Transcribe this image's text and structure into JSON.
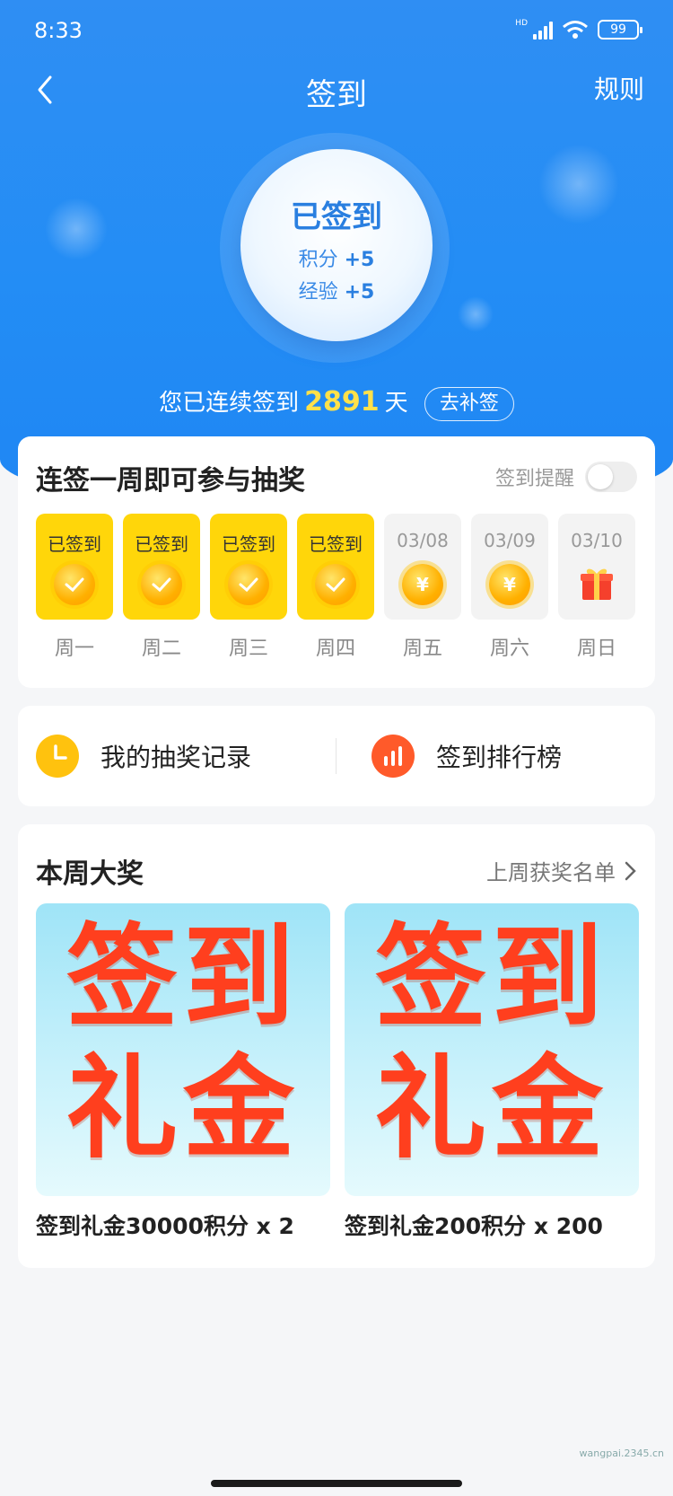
{
  "status_bar": {
    "time": "8:33",
    "network": "HD",
    "battery": "99"
  },
  "nav": {
    "title": "签到",
    "rules": "规则"
  },
  "sign_circle": {
    "status": "已签到",
    "points_label": "积分",
    "points_value": "+5",
    "exp_label": "经验",
    "exp_value": "+5"
  },
  "streak": {
    "prefix": "您已连续签到",
    "days": "2891",
    "suffix": "天",
    "makeup_button": "去补签"
  },
  "week_card": {
    "title": "连签一周即可参与抽奖",
    "reminder_label": "签到提醒",
    "reminder_on": false,
    "days": [
      {
        "label": "已签到",
        "name": "周一",
        "state": "done",
        "icon": "check-coin-icon"
      },
      {
        "label": "已签到",
        "name": "周二",
        "state": "done",
        "icon": "check-coin-icon"
      },
      {
        "label": "已签到",
        "name": "周三",
        "state": "done",
        "icon": "check-coin-icon"
      },
      {
        "label": "已签到",
        "name": "周四",
        "state": "done",
        "icon": "check-coin-icon"
      },
      {
        "label": "03/08",
        "name": "周五",
        "state": "pending",
        "icon": "yen-coin-icon"
      },
      {
        "label": "03/09",
        "name": "周六",
        "state": "pending",
        "icon": "yen-coin-icon"
      },
      {
        "label": "03/10",
        "name": "周日",
        "state": "pending",
        "icon": "gift-icon"
      }
    ]
  },
  "entries": {
    "lottery_record": "我的抽奖记录",
    "ranking": "签到排行榜"
  },
  "prize_card": {
    "title": "本周大奖",
    "last_week_link": "上周获奖名单",
    "prizes": [
      {
        "image_line1": "签到",
        "image_line2": "礼金",
        "name": "签到礼金30000积分 x 2"
      },
      {
        "image_line1": "签到",
        "image_line2": "礼金",
        "name": "签到礼金200积分 x 200"
      }
    ]
  },
  "watermark": "wangpai.2345.cn",
  "colors": {
    "primary_blue": "#238df5",
    "gold": "#ffd60a",
    "streak_number": "#ffe14a",
    "prize_text": "#ff3f1e"
  }
}
